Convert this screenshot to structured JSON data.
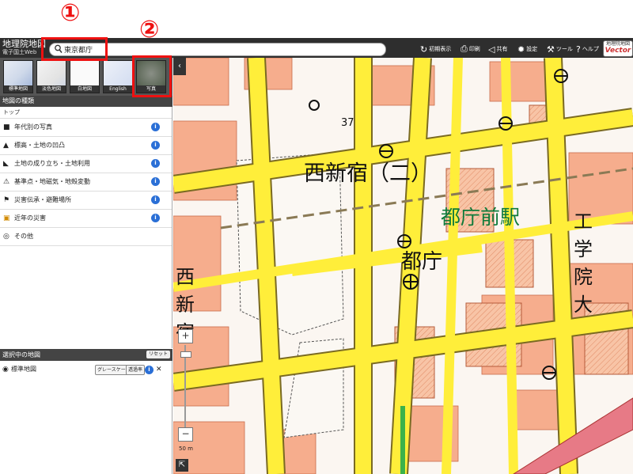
{
  "app": {
    "logo_line1": "地理院地図",
    "logo_line2": "電子国土Web"
  },
  "search": {
    "value": "東京都庁"
  },
  "toolbar": [
    {
      "icon": "reset-view-icon",
      "glyph": "↻",
      "label": "初期表示"
    },
    {
      "icon": "print-icon",
      "glyph": "⎙",
      "label": "印刷"
    },
    {
      "icon": "share-icon",
      "glyph": "◁",
      "label": "共有"
    },
    {
      "icon": "settings-icon",
      "glyph": "✹",
      "label": "設定"
    },
    {
      "icon": "tools-icon",
      "glyph": "⚒",
      "label": "ツール"
    },
    {
      "icon": "help-icon",
      "glyph": "?",
      "label": "ヘルプ"
    }
  ],
  "vector_badge": {
    "top": "地理院地図",
    "main": "Vector"
  },
  "thumbnails": [
    {
      "label": "標準地図"
    },
    {
      "label": "淡色地図"
    },
    {
      "label": "白地図"
    },
    {
      "label": "English"
    },
    {
      "label": "写真"
    }
  ],
  "map_types": {
    "header": "地図の種類",
    "breadcrumb": "トップ",
    "items": [
      {
        "icon": "camera-icon",
        "glyph": "■",
        "label": "年代別の写真",
        "info": "i"
      },
      {
        "icon": "mountain-icon",
        "glyph": "▲",
        "label": "標高・土地の凹凸",
        "info": "i"
      },
      {
        "icon": "land-formation-icon",
        "glyph": "◣",
        "label": "土地の成り立ち・土地利用",
        "info": "i"
      },
      {
        "icon": "benchmark-icon",
        "glyph": "⚠",
        "label": "基準点・地磁気・地殻変動",
        "info": "i"
      },
      {
        "icon": "disaster-monument-icon",
        "glyph": "⚑",
        "label": "災害伝承・避難場所",
        "info": "i"
      },
      {
        "icon": "recent-disaster-icon",
        "glyph": "▣",
        "label": "近年の災害",
        "info": "i"
      },
      {
        "icon": "other-icon",
        "glyph": "◎",
        "label": "その他",
        "info": ""
      }
    ]
  },
  "selected": {
    "header": "選択中の地図",
    "reset_label": "リセット",
    "layer_name": "標準地図",
    "grayscale_label": "グレースケール",
    "legend_label": "透過率",
    "info": "i",
    "close": "✕"
  },
  "zoom": {
    "plus": "+",
    "minus": "−",
    "scale_label": "50 m"
  },
  "map_labels": {
    "district": "西新宿（二）",
    "station": "都庁前駅",
    "city_hall": "都庁",
    "university": [
      "工",
      "学",
      "院",
      "大"
    ],
    "nishi_shinjuku_vertical": [
      "西",
      "新",
      "宿"
    ],
    "elevation": "37"
  },
  "callouts": [
    {
      "num": "①"
    },
    {
      "num": "②"
    }
  ],
  "colors": {
    "topbar": "#2e2e2e",
    "road_major": "#ffee3a",
    "building": "#f7b89a",
    "callout": "#ee1111",
    "station_label": "#0e7a3a"
  }
}
